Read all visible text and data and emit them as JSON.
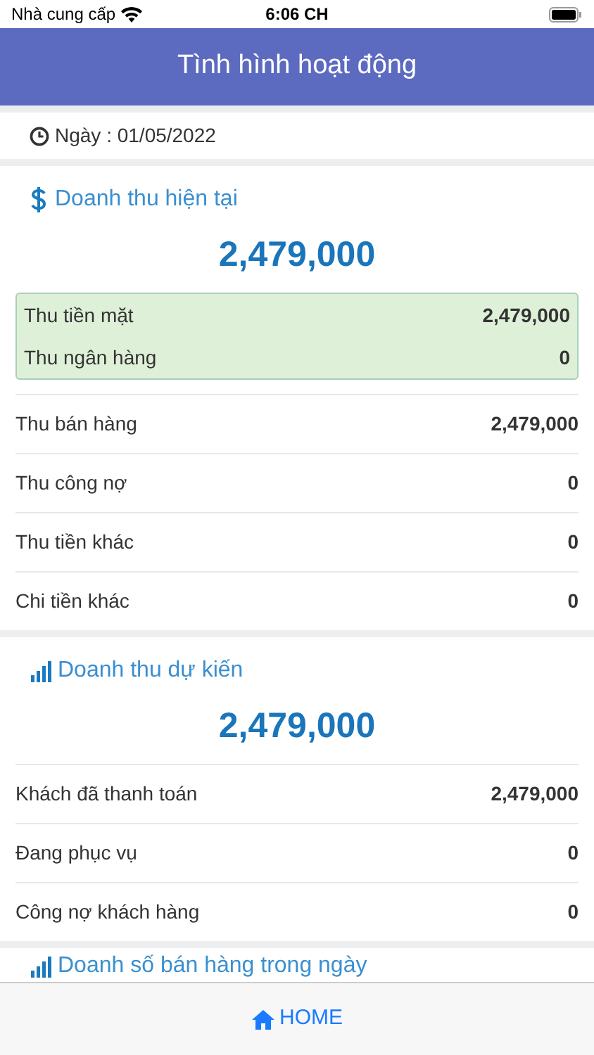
{
  "status_bar": {
    "carrier": "Nhà cung cấp",
    "time": "6:06 CH"
  },
  "header": {
    "title": "Tình hình hoạt động"
  },
  "date": {
    "text": "Ngày : 01/05/2022"
  },
  "sections": [
    {
      "kind": "dollar",
      "title": "Doanh thu hiện tại",
      "total": "2,479,000",
      "highlight": [
        {
          "label": "Thu tiền mặt",
          "value": "2,479,000"
        },
        {
          "label": "Thu ngân hàng",
          "value": "0"
        }
      ],
      "rows": [
        {
          "label": "Thu bán hàng",
          "value": "2,479,000"
        },
        {
          "label": "Thu công nợ",
          "value": "0"
        },
        {
          "label": "Thu tiền khác",
          "value": "0"
        },
        {
          "label": "Chi tiền khác",
          "value": "0"
        }
      ]
    },
    {
      "kind": "bars",
      "title": "Doanh thu dự kiến",
      "total": "2,479,000",
      "rows": [
        {
          "label": "Khách đã thanh toán",
          "value": "2,479,000"
        },
        {
          "label": "Đang phục vụ",
          "value": "0"
        },
        {
          "label": "Công nợ khách hàng",
          "value": "0"
        }
      ]
    },
    {
      "kind": "bars",
      "title": "Doanh số bán hàng trong ngày"
    }
  ],
  "tab_bar": {
    "label": "HOME"
  }
}
